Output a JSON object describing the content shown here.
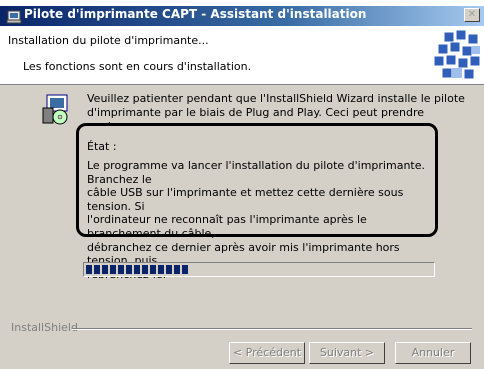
{
  "window": {
    "title": "Pilote d'imprimante CAPT - Assistant d'installation"
  },
  "header": {
    "title": "Installation du pilote d'imprimante...",
    "subtitle": "Les fonctions sont en cours d'installation."
  },
  "body": {
    "intro": "Veuillez patienter pendant que l'InstallShield Wizard installe le pilote\nd'imprimante par le biais de Plug and Play. Ceci peut prendre quelques",
    "status_label": "État :",
    "status_text": "Le programme va lancer l'installation du pilote d'imprimante. Branchez le\ncâble USB sur l'imprimante et mettez cette dernière sous tension. Si\nl'ordinateur ne reconnaît pas l'imprimante après le branchement du câble,\ndébranchez ce dernier après avoir mis l'imprimante hors tension, puis\nrebranchez-le.",
    "progress_fraction": 0.31
  },
  "footer": {
    "brand": "InstallShield",
    "back_label": "< Précédent",
    "next_label": "Suivant >",
    "cancel_label": "Annuler"
  },
  "colors": {
    "title_bar": "#0a246a",
    "dialog_face": "#d4d0c8",
    "progress": "#0a246a"
  },
  "icons": [
    "installer-icon",
    "header-graphic",
    "close-icon"
  ]
}
